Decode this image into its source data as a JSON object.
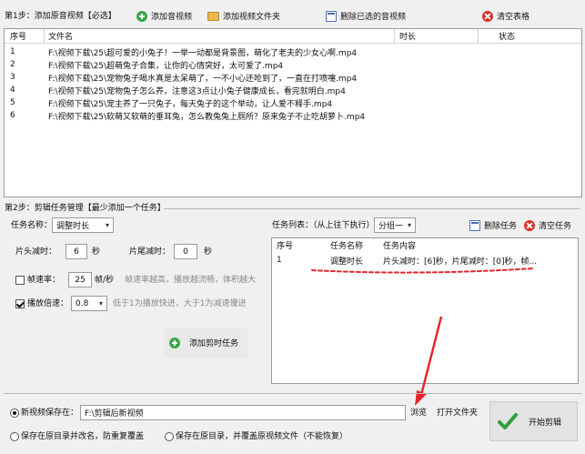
{
  "step1": {
    "label": "第1步：添加原音视频【必选】",
    "add_video_label": "添加音视频",
    "add_folder_label": "添加视频文件夹",
    "delete_selected_label": "删除已选的音视频",
    "clear_table_label": "清空表格",
    "columns": [
      "序号",
      "文件名",
      "时长",
      "状态"
    ],
    "rows": [
      {
        "index": "1",
        "filename": "F:\\视频下载\\25\\超可爱的小兔子！一举一动都是背景图，萌化了老夫的少女心啊.mp4",
        "duration": "",
        "status": ""
      },
      {
        "index": "2",
        "filename": "F:\\视频下载\\25\\超萌兔子合集，让你的心情突好，太可爱了.mp4",
        "duration": "",
        "status": ""
      },
      {
        "index": "3",
        "filename": "F:\\视频下载\\25\\宠物兔子喝水真是太呆萌了，一不小心还呛到了，一直在打喷嚏.mp4",
        "duration": "",
        "status": ""
      },
      {
        "index": "4",
        "filename": "F:\\视频下载\\25\\宠物兔子怎么养，注意这3点让小兔子健康成长，看完就明白.mp4",
        "duration": "",
        "status": ""
      },
      {
        "index": "5",
        "filename": "F:\\视频下载\\25\\宠主养了一只兔子，每天兔子的这个举动，让人爱不释手.mp4",
        "duration": "",
        "status": ""
      },
      {
        "index": "6",
        "filename": "F:\\视频下载\\25\\软萌又软萌的垂耳兔，怎么教兔兔上厕所？原来兔子不止吃胡萝卜.mp4",
        "duration": "",
        "status": ""
      }
    ]
  },
  "step2": {
    "label": "第2步：剪辑任务管理【最少添加一个任务】",
    "task_name_label": "任务名称：",
    "task_name_value": "调整时长",
    "head_cut_label": "片头减时：",
    "head_cut_value": "6",
    "tail_cut_label": "片尾减时：",
    "tail_cut_value": "0",
    "sec_unit": "秒",
    "framerate_label": "帧速率：",
    "framerate_value": "25",
    "framerate_unit": "帧/秒",
    "framerate_hint": "帧速率越高，播放越流畅，体积越大",
    "speed_label": "播放倍速：",
    "speed_value": "0.8",
    "speed_hint": "低于1为播放快进，大于1为减速慢进",
    "add_task_label": "添加剪时任务",
    "task_list_label": "任务列表：（从上往下执行）",
    "group_value": "分组一",
    "delete_task_label": "删除任务",
    "clear_task_label": "清空任务",
    "task_columns": [
      "序号",
      "任务名称",
      "任务内容"
    ],
    "tasks": [
      {
        "index": "1",
        "name": "调整时长",
        "content": "片头减时：[6]秒，片尾减时：[0]秒，帧..."
      }
    ]
  },
  "output": {
    "new_save_label": "新视频保存在：",
    "save_path": "F:\\剪辑后新视频",
    "browse_label": "浏览",
    "open_folder_label": "打开文件夹",
    "rename_label": "保存在原目录并改名，防重复覆盖",
    "overwrite_label": "保存在原目录，并覆盖原视频文件（不能恢复）",
    "start_label": "开始剪辑"
  },
  "colors": {
    "accent_red": "#e5262b",
    "green_add": "#3aa64a",
    "red_clear": "#d93025",
    "start_green": "#2e9e3c"
  },
  "icons": {
    "add_video": "plus-circle-icon",
    "add_folder": "folder-icon",
    "delete_selected": "delete-list-icon",
    "clear": "close-circle-icon",
    "start": "checkmark-icon"
  }
}
